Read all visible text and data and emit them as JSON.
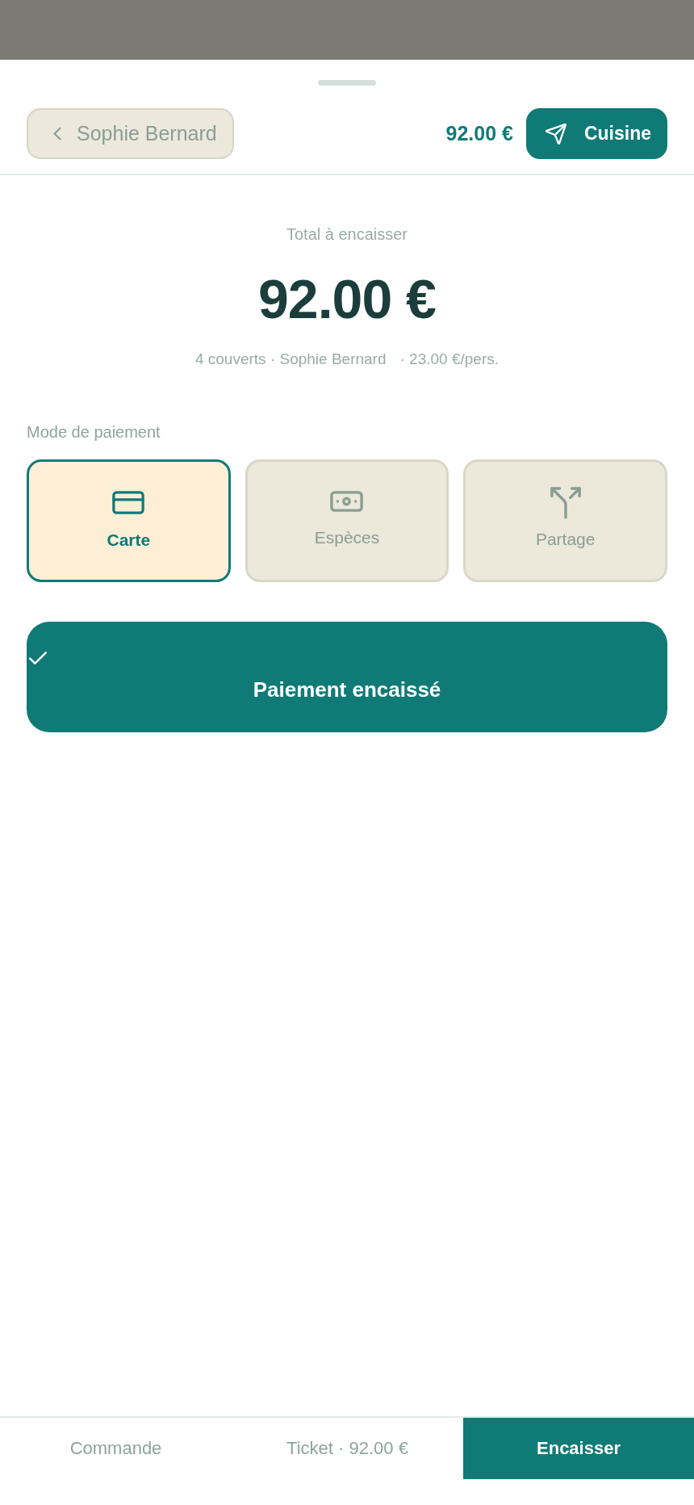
{
  "header": {
    "back_button": {
      "label": "Sophie Bernard"
    },
    "total": "92.00 €",
    "send_button": {
      "label": "Cuisine"
    }
  },
  "summary": {
    "label": "Total à encaisser",
    "amount": "92.00 €",
    "details": [
      "4 couverts · Sophie Bernard",
      "· 23.00 €/pers."
    ]
  },
  "payment": {
    "label": "Mode de paiement",
    "methods": [
      {
        "kind": "card",
        "label": "Carte",
        "selected": true
      },
      {
        "kind": "cash",
        "label": "Espèces",
        "selected": false
      },
      {
        "kind": "split",
        "label": "Partage",
        "selected": false
      }
    ]
  },
  "confirm_button": {
    "label": "Paiement encaissé"
  },
  "bottom_tabs": [
    {
      "label": "Commande",
      "selected": false
    },
    {
      "label": "Ticket · 92.00 €",
      "selected": false
    },
    {
      "label": "Encaisser",
      "selected": true
    }
  ]
}
